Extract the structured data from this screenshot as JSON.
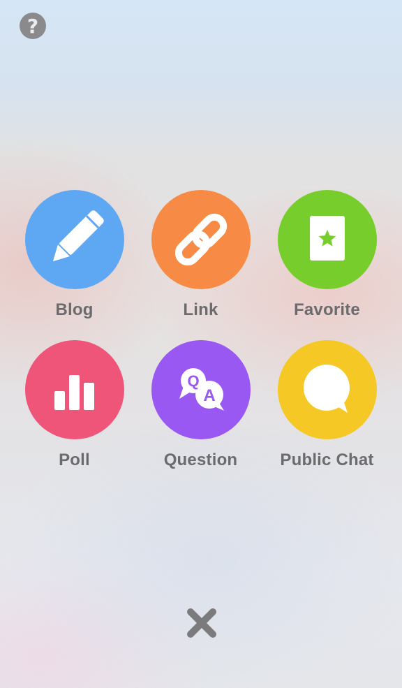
{
  "help_button": {
    "icon": "question-mark-icon",
    "glyph": "?",
    "color": "#8a8a8c"
  },
  "actions": [
    {
      "id": "blog",
      "label": "Blog",
      "icon": "pencil-icon",
      "color": "#5ea8f3"
    },
    {
      "id": "link",
      "label": "Link",
      "icon": "chain-link-icon",
      "color": "#f78a45"
    },
    {
      "id": "favorite",
      "label": "Favorite",
      "icon": "star-card-icon",
      "color": "#77cd2b"
    },
    {
      "id": "poll",
      "label": "Poll",
      "icon": "bar-chart-icon",
      "color": "#ee5578"
    },
    {
      "id": "question",
      "label": "Question",
      "icon": "qa-bubbles-icon",
      "color": "#9a58f2",
      "glyphs": [
        "Q",
        "A"
      ]
    },
    {
      "id": "public-chat",
      "label": "Public Chat",
      "icon": "chat-bubble-icon",
      "color": "#f6c825"
    }
  ],
  "close_button": {
    "icon": "close-icon",
    "color": "#7b7b7e"
  }
}
